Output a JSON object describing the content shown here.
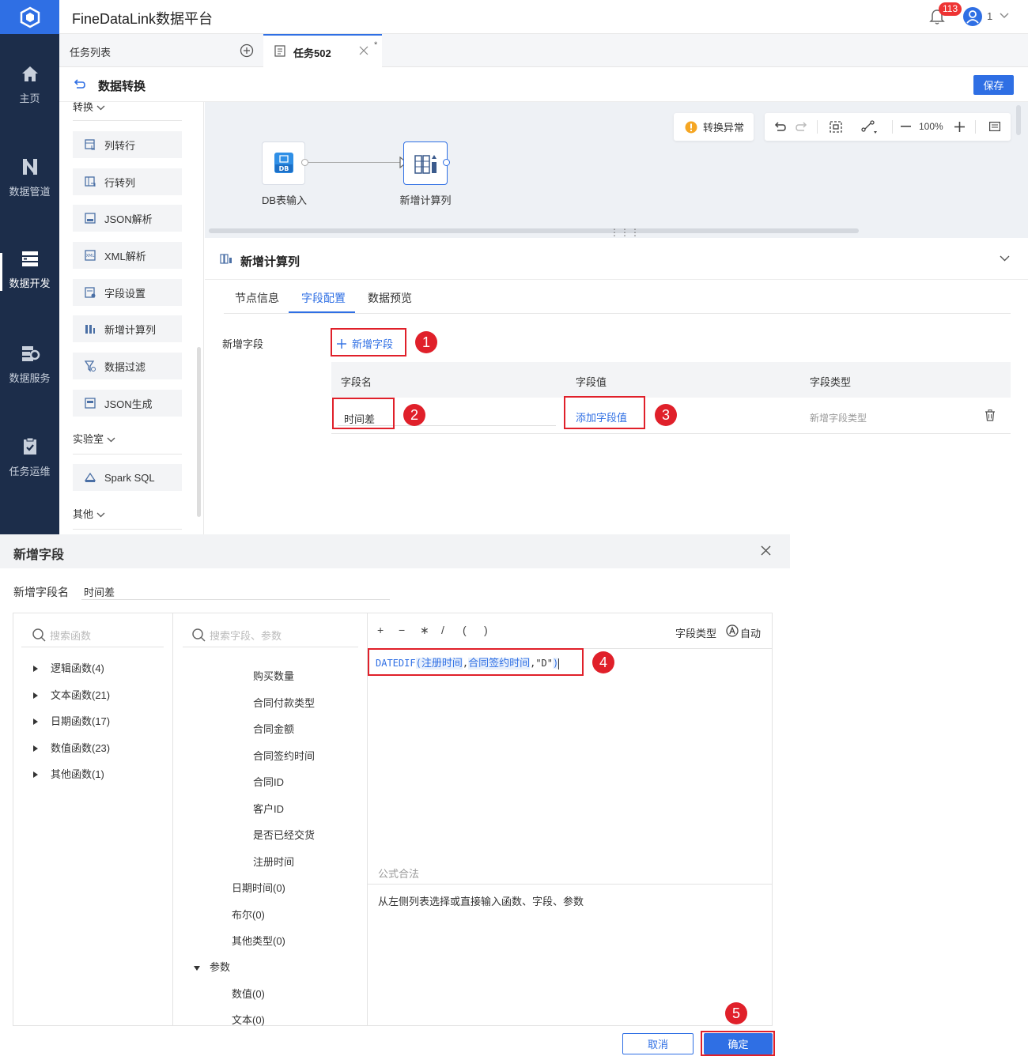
{
  "app": {
    "title": "FineDataLink数据平台",
    "notification_count": "113",
    "user": "1"
  },
  "nav": {
    "items": [
      {
        "label": "主页",
        "icon": "home-icon"
      },
      {
        "label": "数据管道",
        "icon": "pipeline-icon"
      },
      {
        "label": "数据开发",
        "icon": "dev-icon",
        "active": true
      },
      {
        "label": "数据服务",
        "icon": "service-icon"
      },
      {
        "label": "任务运维",
        "icon": "ops-icon"
      }
    ]
  },
  "tabs": {
    "list_label": "任务列表",
    "active_tab": "任务502",
    "modified_mark": "*"
  },
  "toolbar": {
    "title": "数据转换",
    "save_label": "保存"
  },
  "left_panel": {
    "group_transform": "转换",
    "transform_items": [
      "列转行",
      "行转列",
      "JSON解析",
      "XML解析",
      "字段设置",
      "新增计算列",
      "数据过滤",
      "JSON生成"
    ],
    "group_lab": "实验室",
    "lab_items": [
      "Spark SQL"
    ],
    "group_other": "其他"
  },
  "canvas": {
    "warning_label": "转换异常",
    "zoom": "100%",
    "nodes": [
      {
        "label": "DB表输入",
        "icon_text": "DB"
      },
      {
        "label": "新增计算列"
      }
    ]
  },
  "node_panel": {
    "title": "新增计算列",
    "tabs": [
      "节点信息",
      "字段配置",
      "数据预览"
    ],
    "active_tab": "字段配置",
    "new_field_label": "新增字段",
    "add_field_button": "新增字段",
    "table_headers": [
      "字段名",
      "字段值",
      "字段类型"
    ],
    "row": {
      "name": "时间差",
      "value_link": "添加字段值",
      "type": "新增字段类型"
    }
  },
  "dialog": {
    "title": "新增字段",
    "field_name_label": "新增字段名",
    "field_name_value": "时间差",
    "func_search_placeholder": "搜索函数",
    "func_groups": [
      "逻辑函数(4)",
      "文本函数(21)",
      "日期函数(17)",
      "数值函数(23)",
      "其他函数(1)"
    ],
    "field_search_placeholder": "搜索字段、参数",
    "fields": [
      "购买数量",
      "合同付款类型",
      "合同金额",
      "合同签约时间",
      "合同ID",
      "客户ID",
      "是否已经交货",
      "注册时间"
    ],
    "type_groups": [
      "日期时间(0)",
      "布尔(0)",
      "其他类型(0)"
    ],
    "param_group": "参数",
    "param_items": [
      "数值(0)",
      "文本(0)"
    ],
    "operators": [
      "+",
      "−",
      "∗",
      "/",
      "(",
      ")"
    ],
    "field_type_label": "字段类型",
    "field_type_value": "自动",
    "formula": {
      "func": "DATEDIF",
      "lp": "(",
      "arg1": "注册时间",
      "comma1": ",",
      "arg2": "合同签约时间",
      "comma2": ",",
      "arg3": "\"D\"",
      "rp": ")"
    },
    "status": "公式合法",
    "hint": "从左侧列表选择或直接输入函数、字段、参数",
    "cancel_label": "取消",
    "ok_label": "确定"
  },
  "annotations": [
    "1",
    "2",
    "3",
    "4",
    "5"
  ]
}
